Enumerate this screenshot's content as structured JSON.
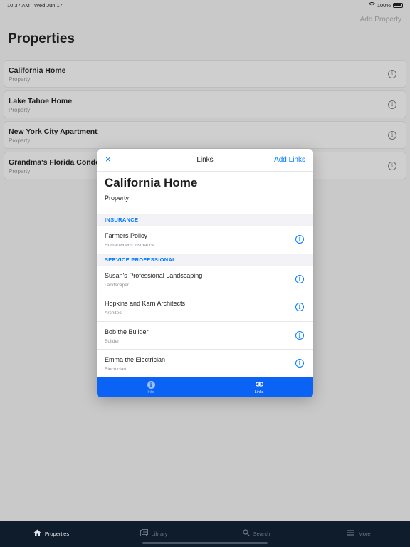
{
  "status": {
    "time": "10:37 AM",
    "date": "Wed Jun 17",
    "battery": "100%"
  },
  "nav": {
    "add_property_label": "Add Property",
    "title": "Properties"
  },
  "properties": [
    {
      "name": "California Home",
      "type": "Property"
    },
    {
      "name": "Lake Tahoe Home",
      "type": "Property"
    },
    {
      "name": "New York City Apartment",
      "type": "Property"
    },
    {
      "name": "Grandma's Florida Condo",
      "type": "Property"
    }
  ],
  "modal": {
    "close_icon": "×",
    "title": "Links",
    "add_links_label": "Add Links",
    "header_name": "California Home",
    "header_type": "Property",
    "sections": [
      {
        "title": "INSURANCE",
        "rows": [
          {
            "title": "Farmers Policy",
            "subtitle": "Homeowner's Insurance"
          }
        ]
      },
      {
        "title": "SERVICE PROFESSIONAL",
        "rows": [
          {
            "title": "Susan's Professional Landscaping",
            "subtitle": "Landscaper"
          },
          {
            "title": "Hopkins and Karn Architects",
            "subtitle": "Architect"
          },
          {
            "title": "Bob the Builder",
            "subtitle": "Builder"
          },
          {
            "title": "Emma the Electrician",
            "subtitle": "Electrician"
          }
        ]
      }
    ],
    "tabs": [
      {
        "label": "Info",
        "icon": "info-icon",
        "selected": false
      },
      {
        "label": "Links",
        "icon": "link-icon",
        "selected": true
      }
    ]
  },
  "bottom_tabs": [
    {
      "label": "Properties",
      "icon": "house-icon",
      "active": true
    },
    {
      "label": "Library",
      "icon": "library-icon",
      "active": false
    },
    {
      "label": "Search",
      "icon": "search-icon",
      "active": false
    },
    {
      "label": "More",
      "icon": "menu-icon",
      "active": false
    }
  ],
  "colors": {
    "accent": "#007aff",
    "tab_bar": "#0f1c2c",
    "modal_tab_bar": "#0a63f5"
  }
}
